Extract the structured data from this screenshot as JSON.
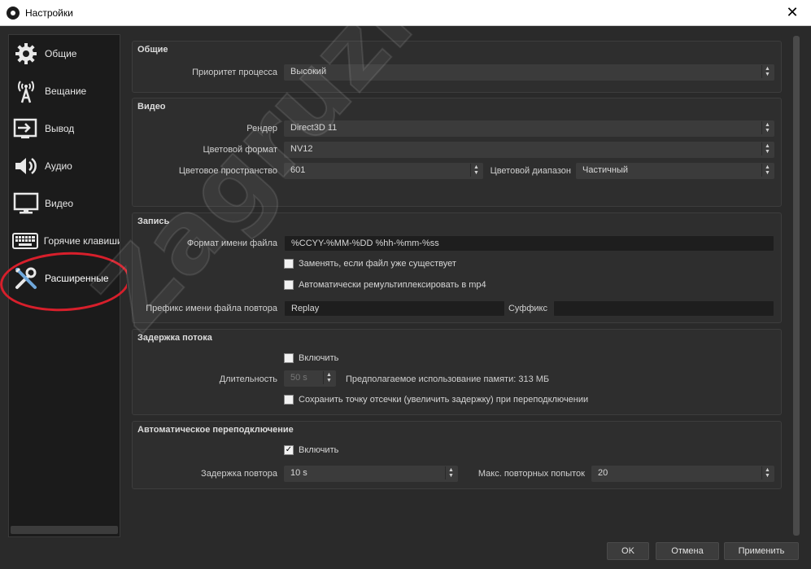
{
  "window": {
    "title": "Настройки"
  },
  "sidebar": {
    "items": [
      {
        "label": "Общие",
        "icon": "gear-icon"
      },
      {
        "label": "Вещание",
        "icon": "broadcast-icon"
      },
      {
        "label": "Вывод",
        "icon": "output-icon"
      },
      {
        "label": "Аудио",
        "icon": "speaker-icon"
      },
      {
        "label": "Видео",
        "icon": "monitor-icon"
      },
      {
        "label": "Горячие клавиши",
        "icon": "keyboard-icon"
      },
      {
        "label": "Расширенные",
        "icon": "tools-icon",
        "active": true
      }
    ]
  },
  "general": {
    "title": "Общие",
    "priority_label": "Приоритет процесса",
    "priority_value": "Высокий"
  },
  "video": {
    "title": "Видео",
    "renderer_label": "Рендер",
    "renderer_value": "Direct3D 11",
    "color_format_label": "Цветовой формат",
    "color_format_value": "NV12",
    "color_space_label": "Цветовое пространство",
    "color_space_value": "601",
    "color_range_label": "Цветовой диапазон",
    "color_range_value": "Частичный"
  },
  "recording": {
    "title": "Запись",
    "filename_format_label": "Формат имени файла",
    "filename_format_value": "%CCYY-%MM-%DD %hh-%mm-%ss",
    "overwrite_label": "Заменять, если файл уже существует",
    "overwrite_checked": false,
    "remux_label": "Автоматически ремультиплексировать в mp4",
    "remux_checked": false,
    "replay_prefix_label": "Префикс имени файла повтора",
    "replay_prefix_value": "Replay",
    "suffix_label": "Суффикс",
    "suffix_value": ""
  },
  "stream_delay": {
    "title": "Задержка потока",
    "enable_label": "Включить",
    "enable_checked": false,
    "duration_label": "Длительность",
    "duration_value": "50 s",
    "memory_text": "Предполагаемое использование памяти: 313 МБ",
    "preserve_label": "Сохранить точку отсечки (увеличить задержку) при переподключении",
    "preserve_checked": false
  },
  "reconnect": {
    "title": "Автоматическое переподключение",
    "enable_label": "Включить",
    "enable_checked": true,
    "retry_delay_label": "Задержка повтора",
    "retry_delay_value": "10 s",
    "max_retries_label": "Макс. повторных попыток",
    "max_retries_value": "20"
  },
  "buttons": {
    "ok": "OK",
    "cancel": "Отмена",
    "apply": "Применить"
  },
  "watermark": "Zagruzi.Top",
  "colors": {
    "accent_ring": "#d71f2b",
    "background": "#2a2a2a",
    "sidebar": "#1b1b1b"
  }
}
